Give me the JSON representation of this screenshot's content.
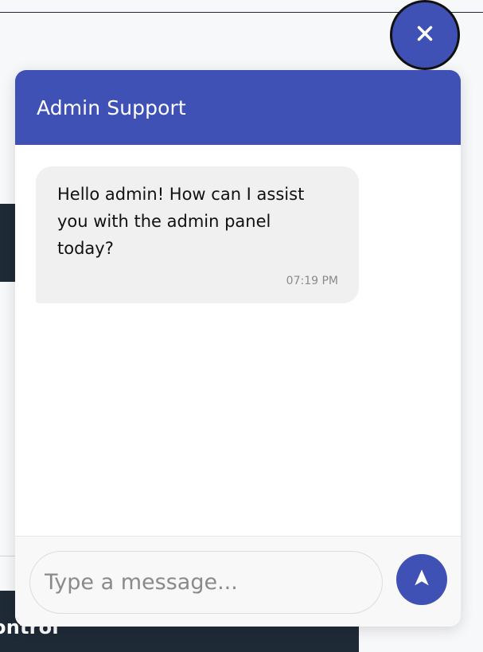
{
  "background": {
    "partial_heading": "ontrol"
  },
  "icons": {
    "close": "close-icon",
    "send": "send-icon"
  },
  "colors": {
    "accent": "#3f51b5",
    "dark_panel": "#1f2a37",
    "bubble_bg": "#f0f0f0",
    "text_main": "#111111",
    "text_muted": "#8a8a8a",
    "surface": "#ffffff"
  },
  "chat": {
    "title": "Admin Support",
    "messages": [
      {
        "text": "Hello admin! How can I assist you with the admin panel today?",
        "time": "07:19 PM"
      }
    ],
    "input": {
      "value": "",
      "placeholder": "Type a message..."
    }
  }
}
